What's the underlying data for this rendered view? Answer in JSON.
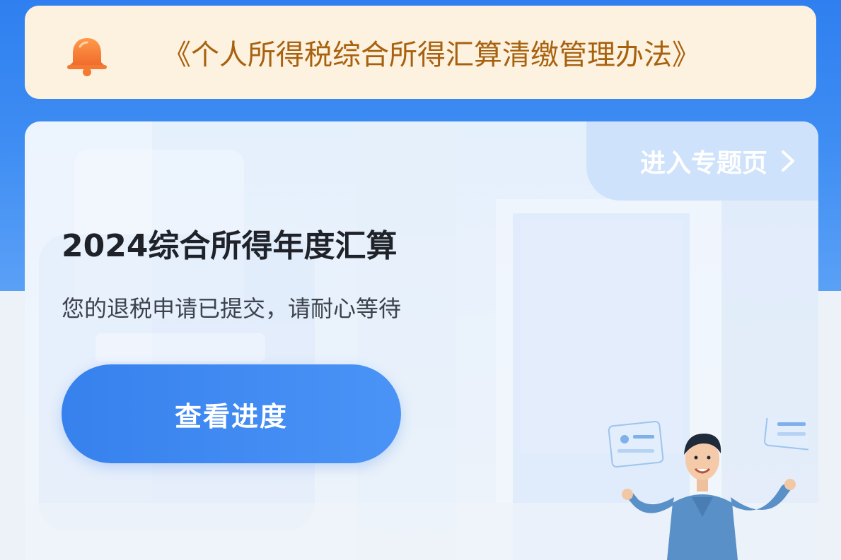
{
  "notice": {
    "icon": "bell-icon",
    "text": "《个人所得税综合所得汇算清缴管理办法》",
    "accent_color": "#a8620f",
    "icon_color": "#f3823d"
  },
  "card": {
    "topic_link_label": "进入专题页",
    "topic_link_icon": "chevron-right-icon",
    "title": "2024综合所得年度汇算",
    "subtitle": "您的退税申请已提交，请耐心等待",
    "button_label": "查看进度",
    "button_color": "#3781ee",
    "illustration": "person-with-floating-cards-illustration"
  }
}
